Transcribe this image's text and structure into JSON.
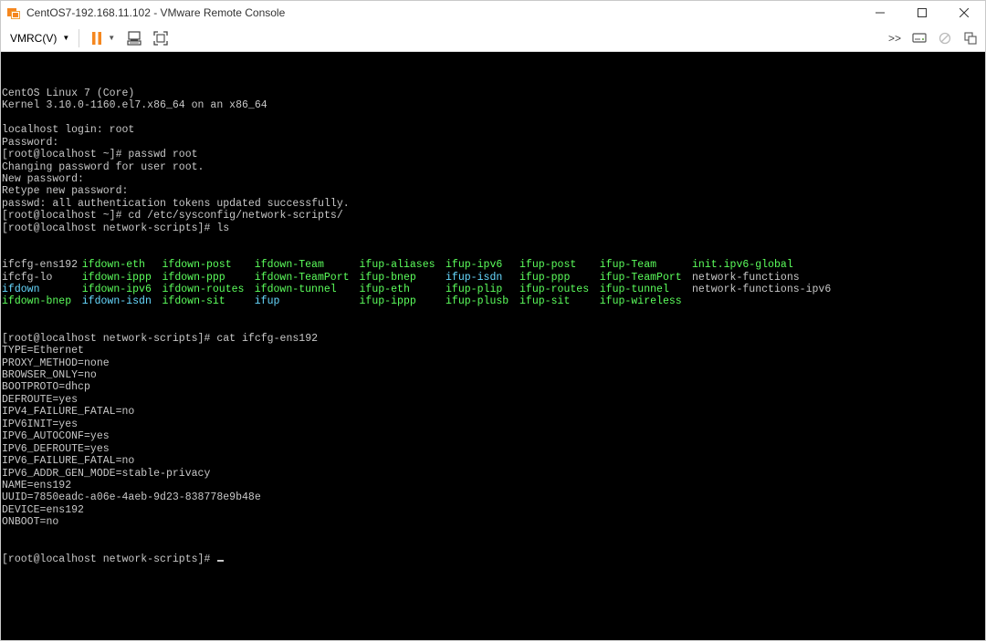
{
  "window": {
    "title": "CentOS7-192.168.11.102 - VMware Remote Console"
  },
  "toolbar": {
    "vmrc_label": "VMRC(V)"
  },
  "colors": {
    "accent_orange": "#f5871f",
    "terminal_bg": "#000000",
    "terminal_fg": "#c8c8c8",
    "exec_green": "#5cff5c",
    "dir_cyan": "#67d9ff"
  },
  "icons": {
    "app": "vmware-remote-console-icon",
    "pause": "pause-icon",
    "send_keys": "send-ctrl-alt-del-icon",
    "fullscreen": "fullscreen-icon",
    "more": "double-chevron-right-icon",
    "removable": "removable-devices-icon",
    "disconnect": "disconnect-icon",
    "copy": "copy-icon"
  },
  "terminal": {
    "pre_lines": [
      "CentOS Linux 7 (Core)",
      "Kernel 3.10.0-1160.el7.x86_64 on an x86_64",
      "",
      "localhost login: root",
      "Password:",
      "[root@localhost ~]# passwd root",
      "Changing password for user root.",
      "New password:",
      "Retype new password:",
      "passwd: all authentication tokens updated successfully.",
      "[root@localhost ~]# cd /etc/sysconfig/network-scripts/",
      "[root@localhost network-scripts]# ls"
    ],
    "ls_rows": [
      [
        {
          "text": "ifcfg-ens192",
          "color": "plain"
        },
        {
          "text": "ifdown-eth",
          "color": "green"
        },
        {
          "text": "ifdown-post",
          "color": "green"
        },
        {
          "text": "ifdown-Team",
          "color": "green"
        },
        {
          "text": "ifup-aliases",
          "color": "green"
        },
        {
          "text": "ifup-ipv6",
          "color": "green"
        },
        {
          "text": "ifup-post",
          "color": "green"
        },
        {
          "text": "ifup-Team",
          "color": "green"
        },
        {
          "text": "init.ipv6-global",
          "color": "green"
        }
      ],
      [
        {
          "text": "ifcfg-lo",
          "color": "plain"
        },
        {
          "text": "ifdown-ippp",
          "color": "green"
        },
        {
          "text": "ifdown-ppp",
          "color": "green"
        },
        {
          "text": "ifdown-TeamPort",
          "color": "green"
        },
        {
          "text": "ifup-bnep",
          "color": "green"
        },
        {
          "text": "ifup-isdn",
          "color": "cyan"
        },
        {
          "text": "ifup-ppp",
          "color": "green"
        },
        {
          "text": "ifup-TeamPort",
          "color": "green"
        },
        {
          "text": "network-functions",
          "color": "plain"
        }
      ],
      [
        {
          "text": "ifdown",
          "color": "cyan"
        },
        {
          "text": "ifdown-ipv6",
          "color": "green"
        },
        {
          "text": "ifdown-routes",
          "color": "green"
        },
        {
          "text": "ifdown-tunnel",
          "color": "green"
        },
        {
          "text": "ifup-eth",
          "color": "green"
        },
        {
          "text": "ifup-plip",
          "color": "green"
        },
        {
          "text": "ifup-routes",
          "color": "green"
        },
        {
          "text": "ifup-tunnel",
          "color": "green"
        },
        {
          "text": "network-functions-ipv6",
          "color": "plain"
        }
      ],
      [
        {
          "text": "ifdown-bnep",
          "color": "green"
        },
        {
          "text": "ifdown-isdn",
          "color": "cyan"
        },
        {
          "text": "ifdown-sit",
          "color": "green"
        },
        {
          "text": "ifup",
          "color": "cyan"
        },
        {
          "text": "ifup-ippp",
          "color": "green"
        },
        {
          "text": "ifup-plusb",
          "color": "green"
        },
        {
          "text": "ifup-sit",
          "color": "green"
        },
        {
          "text": "ifup-wireless",
          "color": "green"
        }
      ]
    ],
    "post_lines": [
      "[root@localhost network-scripts]# cat ifcfg-ens192",
      "TYPE=Ethernet",
      "PROXY_METHOD=none",
      "BROWSER_ONLY=no",
      "BOOTPROTO=dhcp",
      "DEFROUTE=yes",
      "IPV4_FAILURE_FATAL=no",
      "IPV6INIT=yes",
      "IPV6_AUTOCONF=yes",
      "IPV6_DEFROUTE=yes",
      "IPV6_FAILURE_FATAL=no",
      "IPV6_ADDR_GEN_MODE=stable-privacy",
      "NAME=ens192",
      "UUID=7850eadc-a06e-4aeb-9d23-838778e9b48e",
      "DEVICE=ens192",
      "ONBOOT=no"
    ],
    "prompt": "[root@localhost network-scripts]# "
  }
}
